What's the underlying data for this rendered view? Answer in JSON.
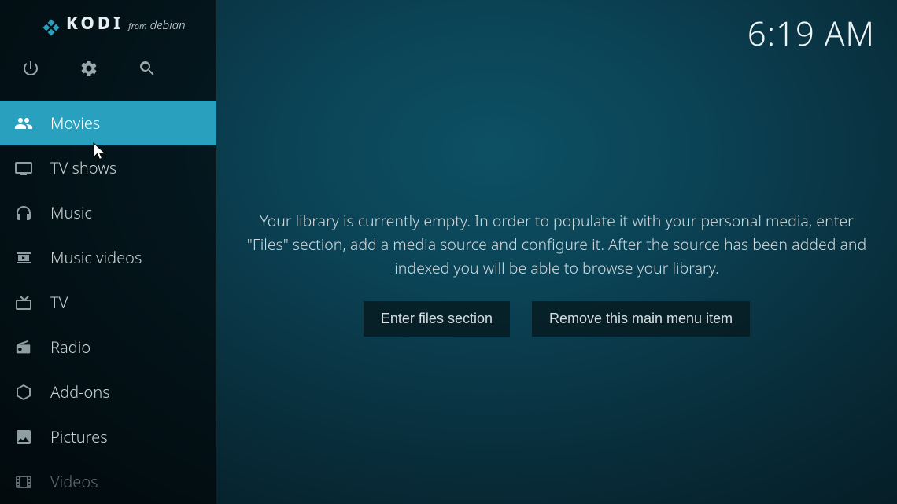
{
  "brand": {
    "name": "KODI",
    "from": "from",
    "distro": "debian"
  },
  "clock": "6:19 AM",
  "nav": {
    "items": [
      {
        "id": "movies",
        "label": "Movies",
        "iconName": "movies-icon",
        "selected": true
      },
      {
        "id": "tvshows",
        "label": "TV shows",
        "iconName": "tv-icon"
      },
      {
        "id": "music",
        "label": "Music",
        "iconName": "headphones-icon"
      },
      {
        "id": "musicvideos",
        "label": "Music videos",
        "iconName": "music-video-icon"
      },
      {
        "id": "tv",
        "label": "TV",
        "iconName": "livetv-icon"
      },
      {
        "id": "radio",
        "label": "Radio",
        "iconName": "radio-icon"
      },
      {
        "id": "addons",
        "label": "Add-ons",
        "iconName": "addons-icon"
      },
      {
        "id": "pictures",
        "label": "Pictures",
        "iconName": "pictures-icon"
      },
      {
        "id": "videos",
        "label": "Videos",
        "iconName": "videos-icon",
        "dim": true
      }
    ]
  },
  "main": {
    "emptyMessage": "Your library is currently empty. In order to populate it with your personal media, enter \"Files\" section, add a media source and configure it. After the source has been added and indexed you will be able to browse your library.",
    "enterFilesLabel": "Enter files section",
    "removeMenuLabel": "Remove this main menu item"
  },
  "colors": {
    "accent": "#2aa0bf"
  }
}
